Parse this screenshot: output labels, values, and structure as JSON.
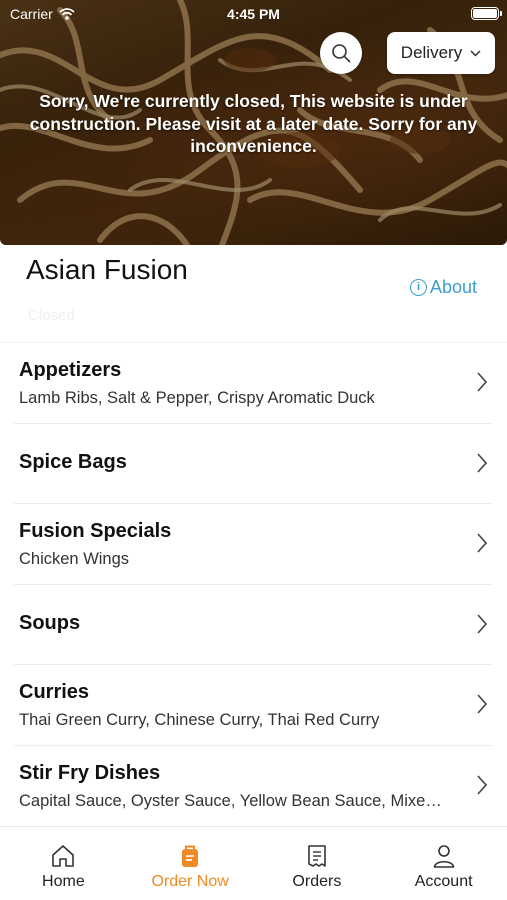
{
  "status_bar": {
    "carrier": "Carrier",
    "time": "4:45 PM"
  },
  "hero": {
    "closed_message": "Sorry, We're currently closed, This website is under construction. Please visit at a later date. Sorry for any inconvenience.",
    "delivery_label": "Delivery",
    "icons": [
      "search-icon",
      "chevron-down-icon"
    ]
  },
  "restaurant": {
    "name": "Asian Fusion",
    "about_label": "About",
    "status_text": "Closed"
  },
  "categories": [
    {
      "title": "Appetizers",
      "subtitle": "Lamb Ribs, Salt & Pepper, Crispy Aromatic Duck"
    },
    {
      "title": "Spice Bags",
      "subtitle": ""
    },
    {
      "title": "Fusion Specials",
      "subtitle": "Chicken Wings"
    },
    {
      "title": "Soups",
      "subtitle": ""
    },
    {
      "title": "Curries",
      "subtitle": "Thai Green Curry, Chinese Curry, Thai Red Curry"
    },
    {
      "title": "Stir Fry Dishes",
      "subtitle": "Capital Sauce, Oyster Sauce, Yellow Bean Sauce, Mixe…"
    }
  ],
  "tabbar": {
    "active": "Order Now",
    "tabs": [
      {
        "label": "Home",
        "icon": "home-icon"
      },
      {
        "label": "Order Now",
        "icon": "order-bag-icon"
      },
      {
        "label": "Orders",
        "icon": "receipt-icon"
      },
      {
        "label": "Account",
        "icon": "account-icon"
      }
    ]
  },
  "colors": {
    "accent": "#f08a24",
    "link": "#3a9fcf",
    "text": "#111111"
  }
}
